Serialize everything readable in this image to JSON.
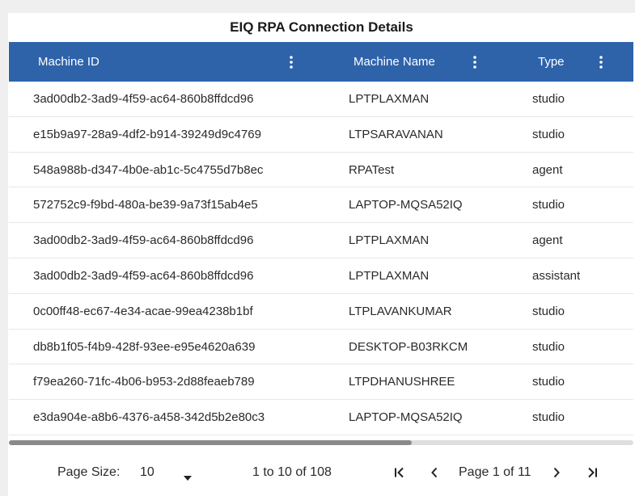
{
  "table": {
    "title": "EIQ RPA Connection Details",
    "columns": [
      {
        "label": "Machine ID"
      },
      {
        "label": "Machine Name"
      },
      {
        "label": "Type"
      }
    ],
    "rows": [
      {
        "machine_id": "3ad00db2-3ad9-4f59-ac64-860b8ffdcd96",
        "machine_name": "LPTPLAXMAN",
        "type": "studio"
      },
      {
        "machine_id": "e15b9a97-28a9-4df2-b914-39249d9c4769",
        "machine_name": "LTPSARAVANAN",
        "type": "studio"
      },
      {
        "machine_id": "548a988b-d347-4b0e-ab1c-5c4755d7b8ec",
        "machine_name": "RPATest",
        "type": "agent"
      },
      {
        "machine_id": "572752c9-f9bd-480a-be39-9a73f15ab4e5",
        "machine_name": "LAPTOP-MQSA52IQ",
        "type": "studio"
      },
      {
        "machine_id": "3ad00db2-3ad9-4f59-ac64-860b8ffdcd96",
        "machine_name": "LPTPLAXMAN",
        "type": "agent"
      },
      {
        "machine_id": "3ad00db2-3ad9-4f59-ac64-860b8ffdcd96",
        "machine_name": "LPTPLAXMAN",
        "type": "assistant"
      },
      {
        "machine_id": "0c00ff48-ec67-4e34-acae-99ea4238b1bf",
        "machine_name": "LTPLAVANKUMAR",
        "type": "studio"
      },
      {
        "machine_id": "db8b1f05-f4b9-428f-93ee-e95e4620a639",
        "machine_name": "DESKTOP-B03RKCM",
        "type": "studio"
      },
      {
        "machine_id": "f79ea260-71fc-4b06-b953-2d88feaeb789",
        "machine_name": "LTPDHANUSHREE",
        "type": "studio"
      },
      {
        "machine_id": "e3da904e-a8b6-4376-a458-342d5b2e80c3",
        "machine_name": "LAPTOP-MQSA52IQ",
        "type": "studio"
      }
    ]
  },
  "pagination": {
    "page_size_label": "Page Size:",
    "page_size_value": "10",
    "range_text": "1 to 10 of 108",
    "page_text": "Page 1 of 11"
  },
  "icons": {
    "column_menu": "kebab-vertical-icon",
    "dropdown": "caret-down-icon",
    "first": "first-page-icon",
    "prev": "chevron-left-icon",
    "next": "chevron-right-icon",
    "last": "last-page-icon"
  },
  "colors": {
    "header_bg": "#2e63aa",
    "page_bg": "#efefef",
    "panel_bg": "#ffffff"
  }
}
